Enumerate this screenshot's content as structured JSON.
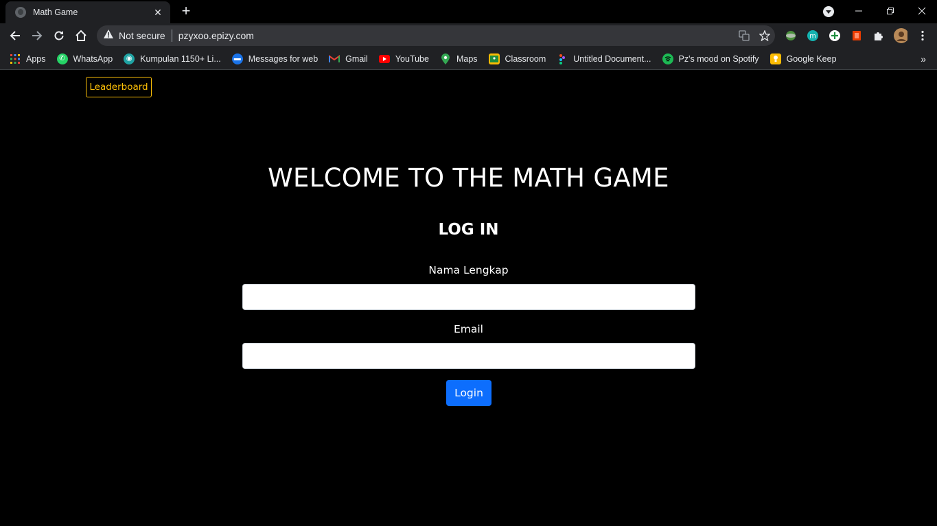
{
  "browser": {
    "tab_title": "Math Game",
    "security_label": "Not secure",
    "url": "pzyxoo.epizy.com",
    "bookmarks": [
      {
        "label": "Apps",
        "icon": "apps-grid-icon"
      },
      {
        "label": "WhatsApp",
        "icon": "whatsapp-icon",
        "color": "#25d366"
      },
      {
        "label": "Kumpulan 1150+ Li...",
        "icon": "kumpulan-icon",
        "color": "#1fa3a3"
      },
      {
        "label": "Messages for web",
        "icon": "messages-icon",
        "color": "#1a73e8"
      },
      {
        "label": "Gmail",
        "icon": "gmail-icon",
        "color": "#ea4335"
      },
      {
        "label": "YouTube",
        "icon": "youtube-icon",
        "color": "#ff0000"
      },
      {
        "label": "Maps",
        "icon": "maps-icon",
        "color": "#34a853"
      },
      {
        "label": "Classroom",
        "icon": "classroom-icon",
        "color": "#fbbc04"
      },
      {
        "label": "Untitled Document...",
        "icon": "document-icon",
        "color": "#a142f4"
      },
      {
        "label": "Pz's mood on Spotify",
        "icon": "spotify-icon",
        "color": "#1db954"
      },
      {
        "label": "Google Keep",
        "icon": "keep-icon",
        "color": "#fbbc04"
      }
    ]
  },
  "page": {
    "leaderboard_label": "Leaderboard",
    "welcome_heading": "WELCOME TO THE MATH GAME",
    "login_heading": "LOG IN",
    "name_label": "Nama Lengkap",
    "name_value": "",
    "email_label": "Email",
    "email_value": "",
    "login_button": "Login"
  },
  "colors": {
    "accent_warning": "#ffc107",
    "primary_button": "#0d6efd",
    "page_background": "#000000"
  }
}
